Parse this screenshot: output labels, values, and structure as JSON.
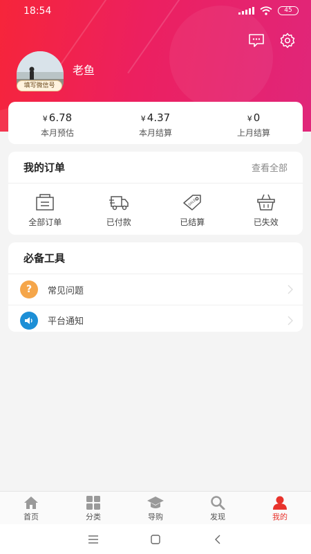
{
  "status_bar": {
    "time": "18:54",
    "battery": "45"
  },
  "profile": {
    "name": "老鱼",
    "avatar_tag": "填写微信号"
  },
  "earnings": [
    {
      "currency": "¥",
      "value": "6.78",
      "label": "本月预估"
    },
    {
      "currency": "¥",
      "value": "4.37",
      "label": "本月结算"
    },
    {
      "currency": "¥",
      "value": "0",
      "label": "上月结算"
    }
  ],
  "orders": {
    "title": "我的订单",
    "view_all": "查看全部",
    "items": [
      {
        "label": "全部订单",
        "icon": "order-list-icon"
      },
      {
        "label": "已付款",
        "icon": "delivery-truck-icon"
      },
      {
        "label": "已结算",
        "icon": "sale-tag-icon"
      },
      {
        "label": "已失效",
        "icon": "basket-icon"
      }
    ]
  },
  "tools": {
    "title": "必备工具",
    "items": [
      {
        "label": "常见问题",
        "icon": "question-icon",
        "color": "#f5a64a"
      },
      {
        "label": "平台通知",
        "icon": "speaker-icon",
        "color": "#1d8fd6"
      }
    ]
  },
  "tabs": [
    {
      "label": "首页",
      "icon": "home-icon",
      "active": false
    },
    {
      "label": "分类",
      "icon": "grid-icon",
      "active": false
    },
    {
      "label": "导购",
      "icon": "graduation-cap-icon",
      "active": false
    },
    {
      "label": "发现",
      "icon": "search-icon",
      "active": false
    },
    {
      "label": "我的",
      "icon": "person-icon",
      "active": true
    }
  ],
  "colors": {
    "header_start": "#f6253a",
    "header_end": "#e0267a",
    "active_tab": "#e8332c",
    "inactive_icon": "#9a9a9a"
  }
}
